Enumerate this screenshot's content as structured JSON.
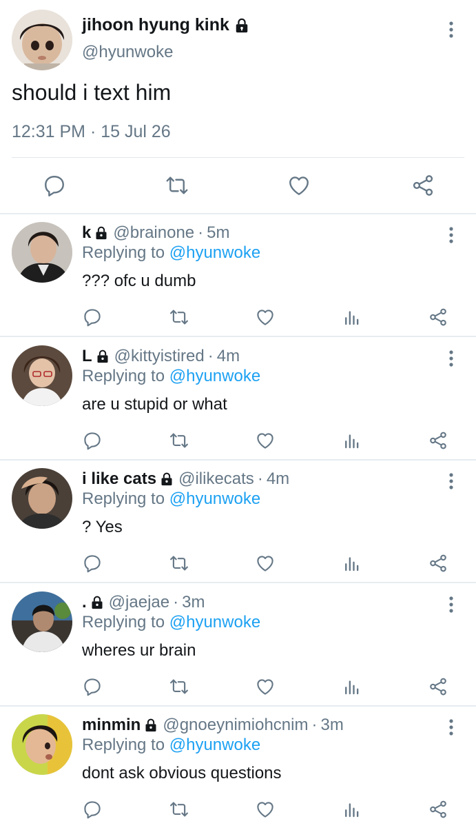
{
  "tweet": {
    "display_name": "jihoon hyung kink",
    "handle": "@hyunwoke",
    "text": "should i text him",
    "timestamp": "12:31 PM · 15 Jul 26",
    "actions": [
      "reply-icon",
      "retweet-icon",
      "like-icon",
      "share-icon"
    ]
  },
  "replies": [
    {
      "name": "k",
      "handle": "@brainone",
      "time": "5m",
      "replying_prefix": "Replying to",
      "replying_to": "@hyunwoke",
      "text": "??? ofc u dumb"
    },
    {
      "name": "L",
      "handle": "@kittyistired",
      "time": "4m",
      "replying_prefix": "Replying to",
      "replying_to": "@hyunwoke",
      "text": "are u stupid or what"
    },
    {
      "name": "i like cats",
      "handle": "@ilikecats",
      "time": "4m",
      "replying_prefix": "Replying to",
      "replying_to": "@hyunwoke",
      "text": "? Yes"
    },
    {
      "name": ".",
      "handle": "@jaejae",
      "time": "3m",
      "replying_prefix": "Replying to",
      "replying_to": "@hyunwoke",
      "text": "wheres ur brain"
    },
    {
      "name": "minmin",
      "handle": "@gnoeynimiohcnim",
      "time": "3m",
      "replying_prefix": "Replying to",
      "replying_to": "@hyunwoke",
      "text": "dont ask obvious questions"
    }
  ],
  "reply_actions": [
    "reply-icon",
    "retweet-icon",
    "like-icon",
    "analytics-icon",
    "share-icon"
  ],
  "colors": {
    "text_primary": "#14171a",
    "text_secondary": "#657786",
    "mention": "#1da1f2",
    "icon": "#657786",
    "divider": "#e6ecf0"
  }
}
